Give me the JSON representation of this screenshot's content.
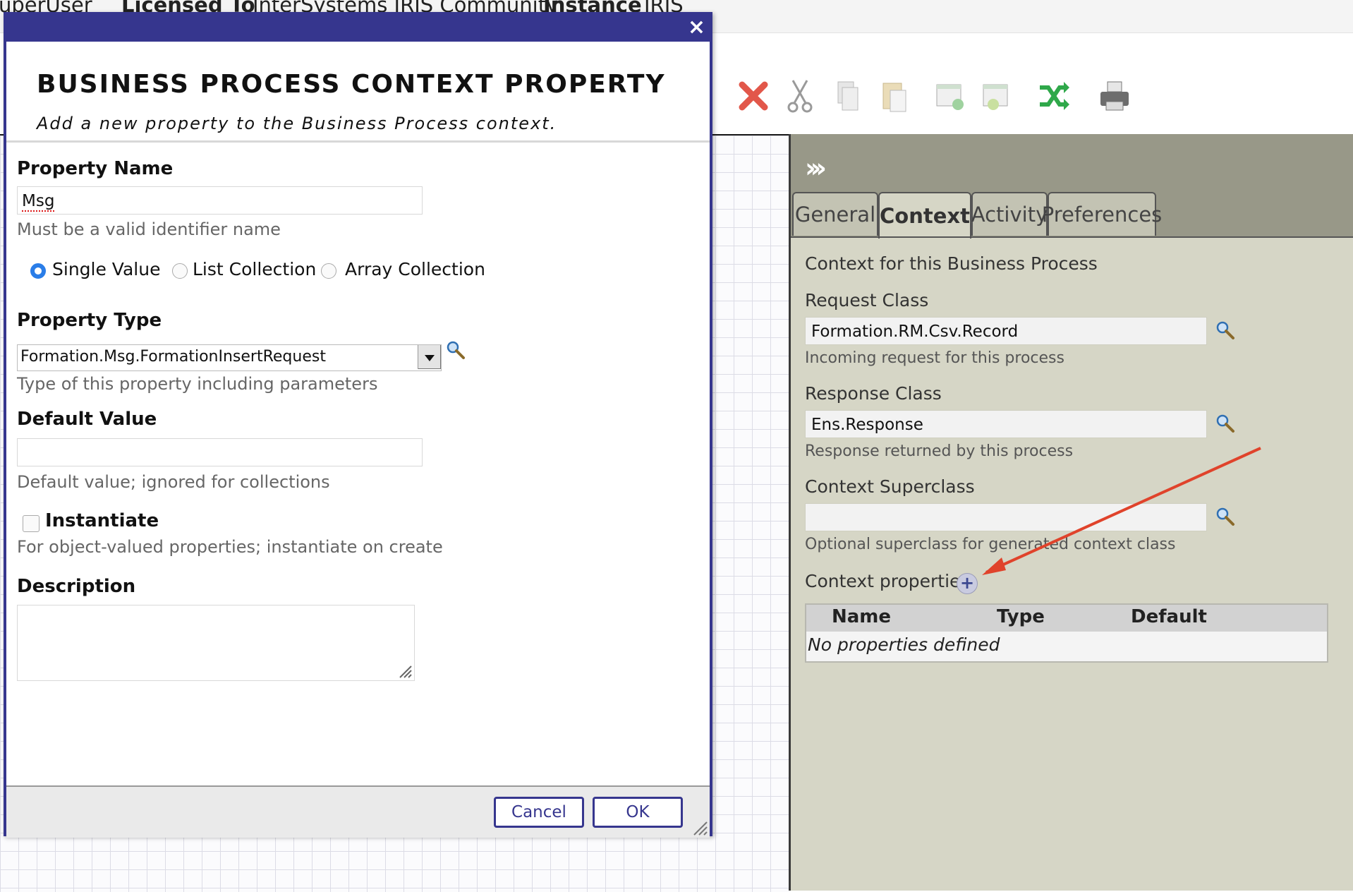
{
  "topbar": {
    "user_value": "uperUser",
    "licensed_label": "Licensed To",
    "licensed_value": "InterSystems IRIS Community",
    "instance_label": "Instance",
    "instance_value": "IRIS"
  },
  "toolbar": {
    "icons": [
      "delete-icon",
      "cut-icon",
      "copy-icon",
      "paste-icon",
      "group-add-icon",
      "group-remove-icon",
      "shuffle-icon",
      "print-icon"
    ]
  },
  "dialog": {
    "title": "BUSINESS PROCESS CONTEXT PROPERTY",
    "subtitle": "Add a new property to the Business Process context.",
    "property_name": {
      "label": "Property Name",
      "value": "Msg",
      "hint": "Must be a valid identifier name"
    },
    "collection_options": [
      {
        "label": "Single Value",
        "selected": true
      },
      {
        "label": "List Collection",
        "selected": false
      },
      {
        "label": "Array Collection",
        "selected": false
      }
    ],
    "property_type": {
      "label": "Property Type",
      "value": "Formation.Msg.FormationInsertRequest",
      "hint": "Type of this property including parameters"
    },
    "default_value": {
      "label": "Default Value",
      "value": "",
      "hint": "Default value; ignored for collections"
    },
    "instantiate": {
      "label": "Instantiate",
      "checked": false,
      "hint": "For object-valued properties; instantiate on create"
    },
    "description": {
      "label": "Description",
      "value": ""
    },
    "buttons": {
      "cancel": "Cancel",
      "ok": "OK"
    }
  },
  "panel": {
    "tabs": [
      {
        "label": "General",
        "active": false
      },
      {
        "label": "Context",
        "active": true
      },
      {
        "label": "Activity",
        "active": false
      },
      {
        "label": "Preferences",
        "active": false
      }
    ],
    "heading": "Context for this Business Process",
    "request_class": {
      "label": "Request Class",
      "value": "Formation.RM.Csv.Record",
      "hint": "Incoming request for this process"
    },
    "response_class": {
      "label": "Response Class",
      "value": "Ens.Response",
      "hint": "Response returned by this process"
    },
    "context_superclass": {
      "label": "Context Superclass",
      "value": "",
      "hint": "Optional superclass for generated context class"
    },
    "context_properties": {
      "label": "Context properties",
      "columns": [
        "Name",
        "Type",
        "Default"
      ],
      "empty_text": "No properties defined"
    }
  },
  "colors": {
    "dialog_accent": "#36368e",
    "panel_bg": "#d6d6c6",
    "panel_header": "#989888",
    "annotation_arrow": "#e0432b"
  }
}
